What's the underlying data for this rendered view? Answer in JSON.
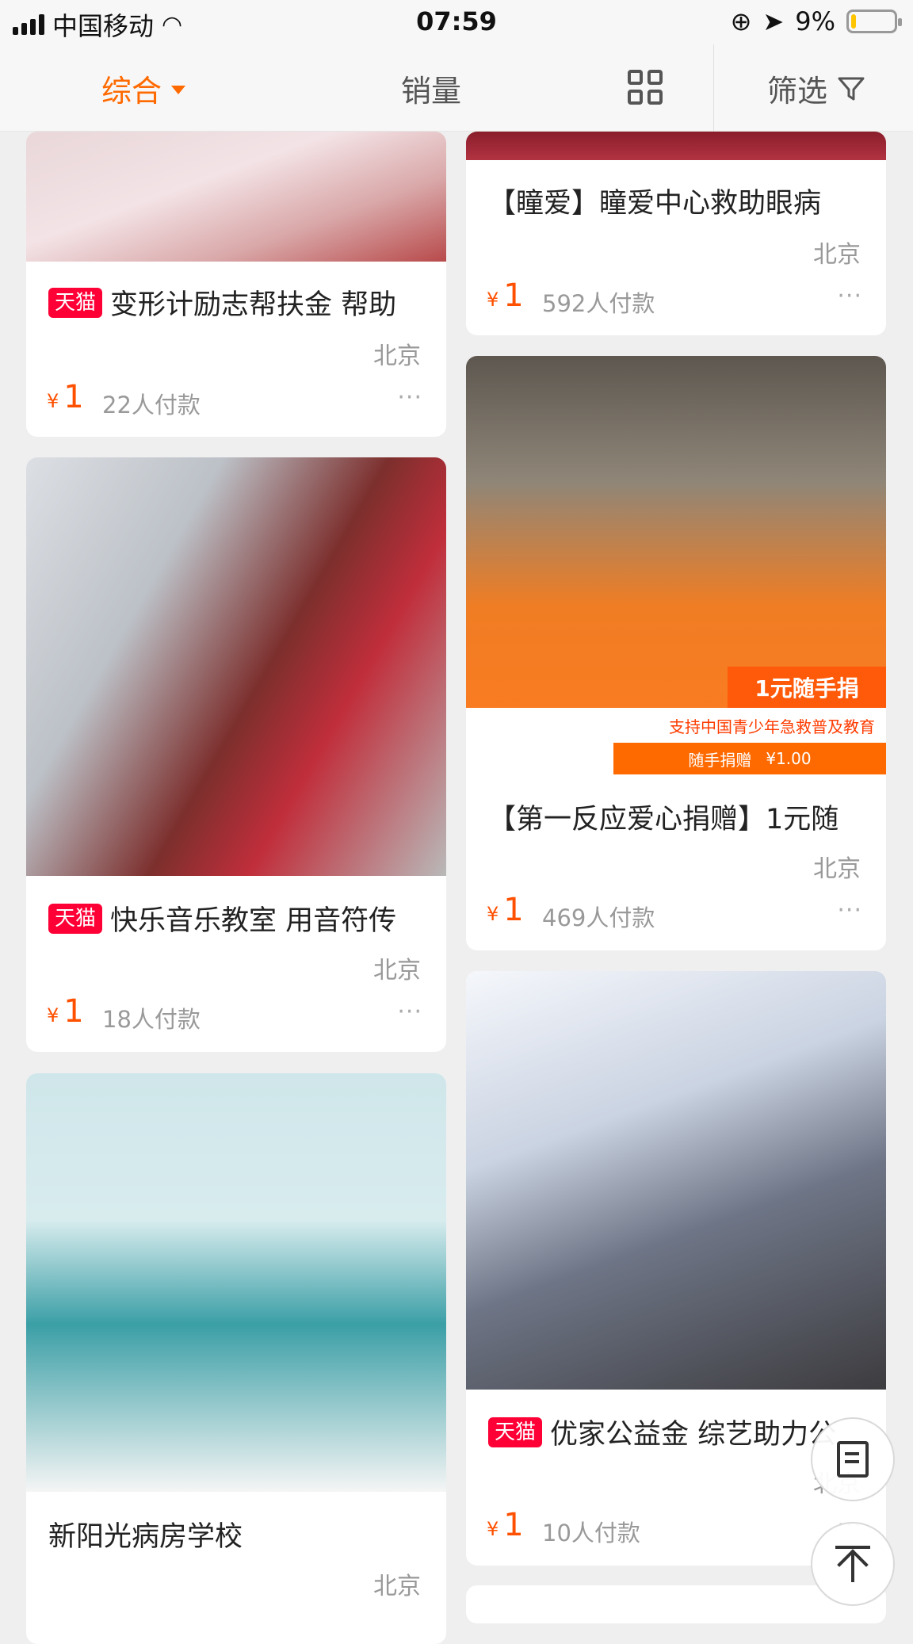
{
  "status_bar": {
    "carrier": "中国移动",
    "time": "07:59",
    "battery": "9%",
    "battery_level": 0.09
  },
  "filter_bar": {
    "comprehensive": "综合",
    "sales": "销量",
    "filter": "筛选"
  },
  "cards": [
    {
      "title": "变形计励志帮扶金 帮助",
      "tmall": "天猫",
      "location": "北京",
      "currency": "¥",
      "price": "1",
      "paid": "22人付款",
      "more": "···"
    },
    {
      "title": "【瞳爱】瞳爱中心救助眼病",
      "tmall": "",
      "location": "北京",
      "currency": "¥",
      "price": "1",
      "paid": "592人付款",
      "more": "···"
    },
    {
      "title": "快乐音乐教室 用音符传",
      "tmall": "天猫",
      "location": "北京",
      "currency": "¥",
      "price": "1",
      "paid": "18人付款",
      "more": "···"
    },
    {
      "title": "【第一反应爱心捐赠】1元随",
      "tmall": "",
      "location": "北京",
      "currency": "¥",
      "price": "1",
      "paid": "469人付款",
      "more": "···",
      "image_badge": "1元随手捐",
      "image_caption": "支持中国青少年急救普及教育",
      "image_strip_left": "随手捐赠",
      "image_strip_right": "¥1.00"
    },
    {
      "title": "新阳光病房学校",
      "tmall": "",
      "location": "北京"
    },
    {
      "title": "优家公益金 综艺助力公",
      "tmall": "天猫",
      "location": "北京",
      "currency": "¥",
      "price": "1",
      "paid": "10人付款",
      "more": "···"
    }
  ]
}
